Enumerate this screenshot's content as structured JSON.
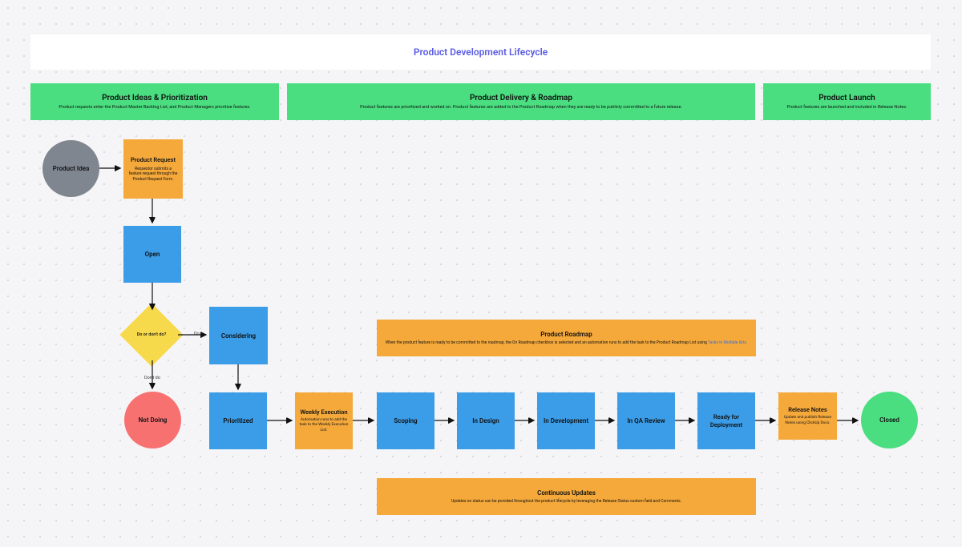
{
  "title": "Product Development Lifecycle",
  "lanes": {
    "ideas": {
      "title": "Product Ideas & Prioritization",
      "sub": "Product requests enter the Product Master Backlog List, and Product Managers prioritize features."
    },
    "delivery": {
      "title": "Product Delivery & Roadmap",
      "sub": "Product features are prioritized and worked on. Product features are added to the Product Roadmap when they are ready to be publicly committed to a future release."
    },
    "launch": {
      "title": "Product Launch",
      "sub": "Product features are launched and included in Release Notes."
    }
  },
  "nodes": {
    "idea": "Product Idea",
    "request": {
      "title": "Product Request",
      "sub": "Requestor submits a feature request through the Product Request Form."
    },
    "open": "Open",
    "decision": "Do or don't do?",
    "considering": "Considering",
    "notdoing": "Not Doing",
    "prioritized": "Prioritized",
    "weekly": {
      "title": "Weekly Execution",
      "sub": "Automation runs to add the task to the Weekly Execution List."
    },
    "scoping": "Scoping",
    "design": "In Design",
    "development": "In Development",
    "qa": "In QA Review",
    "ready": "Ready for Deployment",
    "notes": {
      "title": "Release Notes",
      "sub": "Update and publish Release Notes using ClickUp Docs."
    },
    "closed": "Closed",
    "roadmap": {
      "title": "Product Roadmap",
      "sub": "When the product feature is ready to be committed to the roadmap, the On Roadmap checkbox is selected and an automation runs to add the task to the Product Roadmap List using ",
      "link": "Tasks in Multiple lists."
    },
    "updates": {
      "title": "Continuous Updates",
      "sub": "Updates on status can be provided throughout the product lifecycle by leveraging the Release Status custom field and Comments."
    }
  },
  "edges": {
    "do": "Do",
    "dontdo": "Don't do"
  }
}
